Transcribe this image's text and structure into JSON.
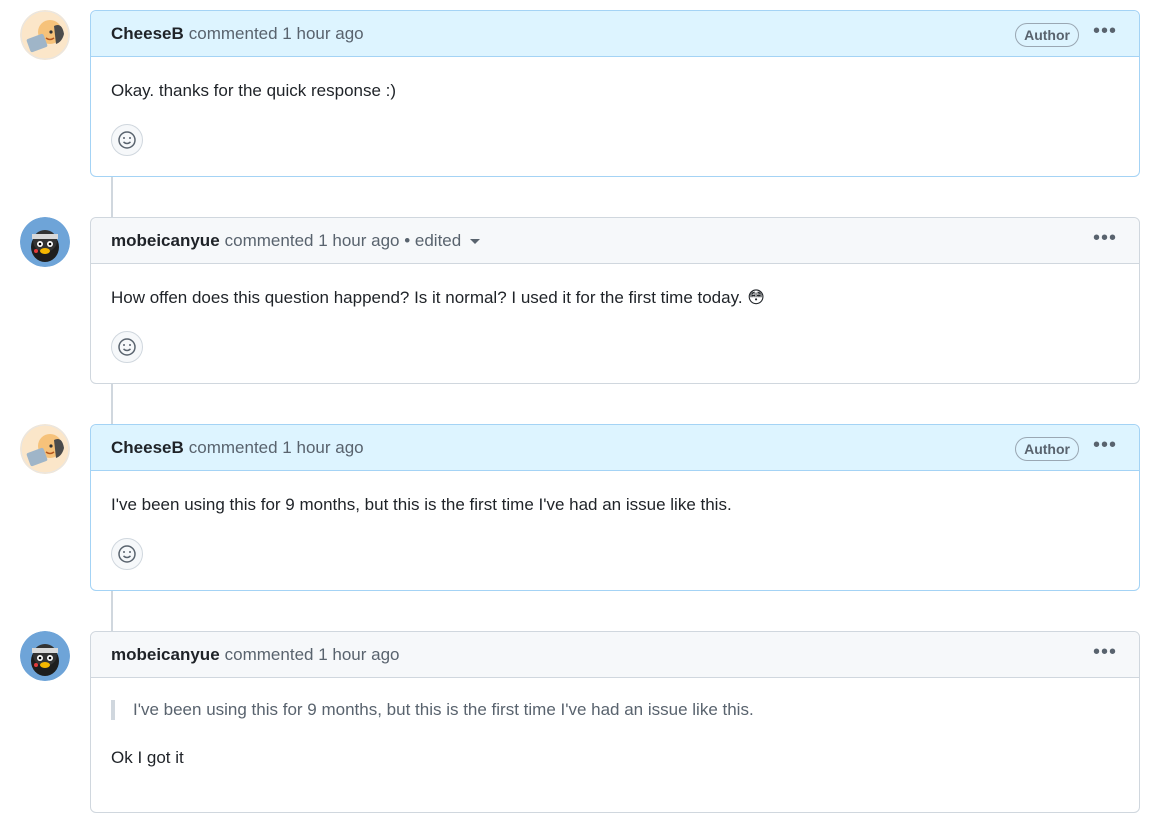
{
  "comments": [
    {
      "user": "CheeseB",
      "meta": "commented 1 hour ago",
      "badge": "Author",
      "body": "Okay. thanks for the quick response :)"
    },
    {
      "user": "mobeicanyue",
      "meta": "commented 1 hour ago • edited",
      "body": "How offen does this question happend? Is it normal? I used it for the first time today. 😳"
    },
    {
      "user": "CheeseB",
      "meta": "commented 1 hour ago",
      "badge": "Author",
      "body": "I've been using this for 9 months, but this is the first time I've had an issue like this."
    },
    {
      "user": "mobeicanyue",
      "meta": "commented 1 hour ago",
      "quote": "I've been using this for 9 months, but this is the first time I've had an issue like this.",
      "body": "Ok I got it"
    }
  ],
  "icons": {
    "more": "kebab-horizontal-icon",
    "reaction": "smiley-icon",
    "edit_caret": "triangle-down-icon"
  },
  "colors": {
    "author_header_bg": "#ddf4ff",
    "author_border": "#a4d3f5",
    "header_bg": "#f6f8fa",
    "border": "#d0d7de",
    "muted_text": "#59636e"
  }
}
